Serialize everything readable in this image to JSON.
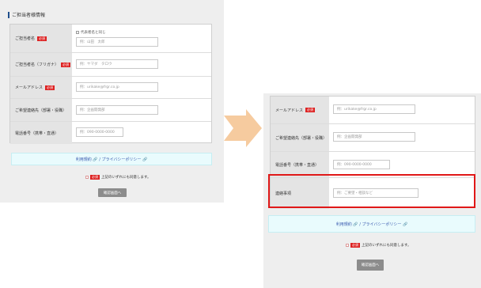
{
  "left": {
    "section_title": "ご担当者様情報",
    "required_badge": "必須",
    "rows": [
      {
        "label": "ご担当者名",
        "required": true,
        "checkbox_text": "代表者名と同じ",
        "placeholder": "例：山田　太郎"
      },
      {
        "label": "ご担当者名（フリガナ）",
        "required": true,
        "placeholder": "例：ヤマダ　タロウ"
      },
      {
        "label": "メールアドレス",
        "required": true,
        "placeholder": "例：urikake@frgr.co.jp"
      },
      {
        "label": "ご希望連絡先（部署・役職）",
        "required": false,
        "placeholder": "例：企画開発部"
      },
      {
        "label": "電話番号（携帯・直通）",
        "required": false,
        "placeholder": "例：090-0000-0000"
      }
    ],
    "privacy_text": "利用規約 🔗 / プライバシーポリシー 🔗",
    "agree_text": "上記のいずれにも同意します。",
    "confirm_button": "確認画面へ"
  },
  "right": {
    "required_badge": "必須",
    "rows": [
      {
        "label": "メールアドレス",
        "required": true,
        "placeholder": "例：urikake@frgr.co.jp"
      },
      {
        "label": "ご希望連絡先（部署・役職）",
        "required": false,
        "placeholder": "例：企画開発部"
      },
      {
        "label": "電話番号（携帯・直通）",
        "required": false,
        "placeholder": "例：090-0000-0000"
      },
      {
        "label": "連絡事項",
        "required": false,
        "placeholder": "例：ご要望・相談など"
      }
    ],
    "privacy_text": "利用規約 🔗 / プライバシーポリシー 🔗",
    "agree_text": "上記のいずれにも同意します。",
    "confirm_button": "確認画面へ"
  },
  "colors": {
    "required": "#dd2222",
    "highlight": "#e01818",
    "arrow": "#f5c89a",
    "privacy_bg": "#e9fbfd",
    "link": "#3a5bb0"
  }
}
